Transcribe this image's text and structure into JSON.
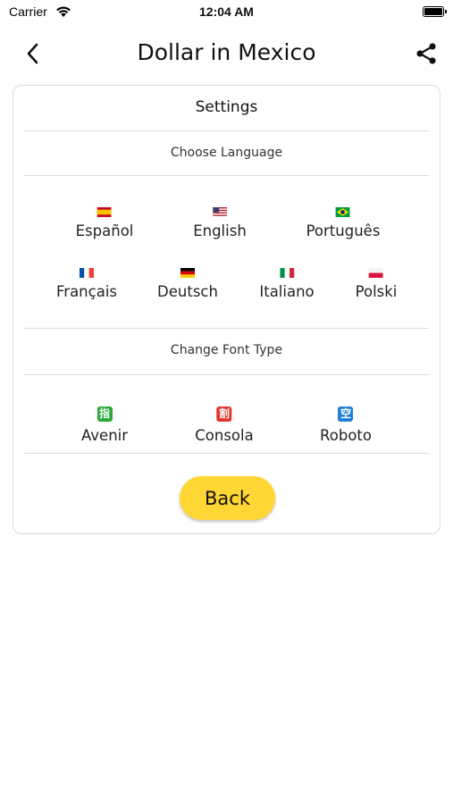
{
  "status_bar": {
    "carrier": "Carrier",
    "time": "12:04 AM"
  },
  "nav": {
    "title": "Dollar in Mexico",
    "back_icon": "chevron-left-icon",
    "share_icon": "share-icon"
  },
  "settings": {
    "title": "Settings",
    "language_section": "Choose Language",
    "languages": [
      "Español",
      "English",
      "Português",
      "Français",
      "Deutsch",
      "Italiano",
      "Polski"
    ],
    "font_section": "Change Font Type",
    "fonts": [
      {
        "label": "Avenir",
        "glyph": "指",
        "color": "#2aa83a"
      },
      {
        "label": "Consola",
        "glyph": "割",
        "color": "#e0362c"
      },
      {
        "label": "Roboto",
        "glyph": "空",
        "color": "#1d7fd6"
      }
    ],
    "back_label": "Back",
    "accent_color": "#ffd633"
  }
}
